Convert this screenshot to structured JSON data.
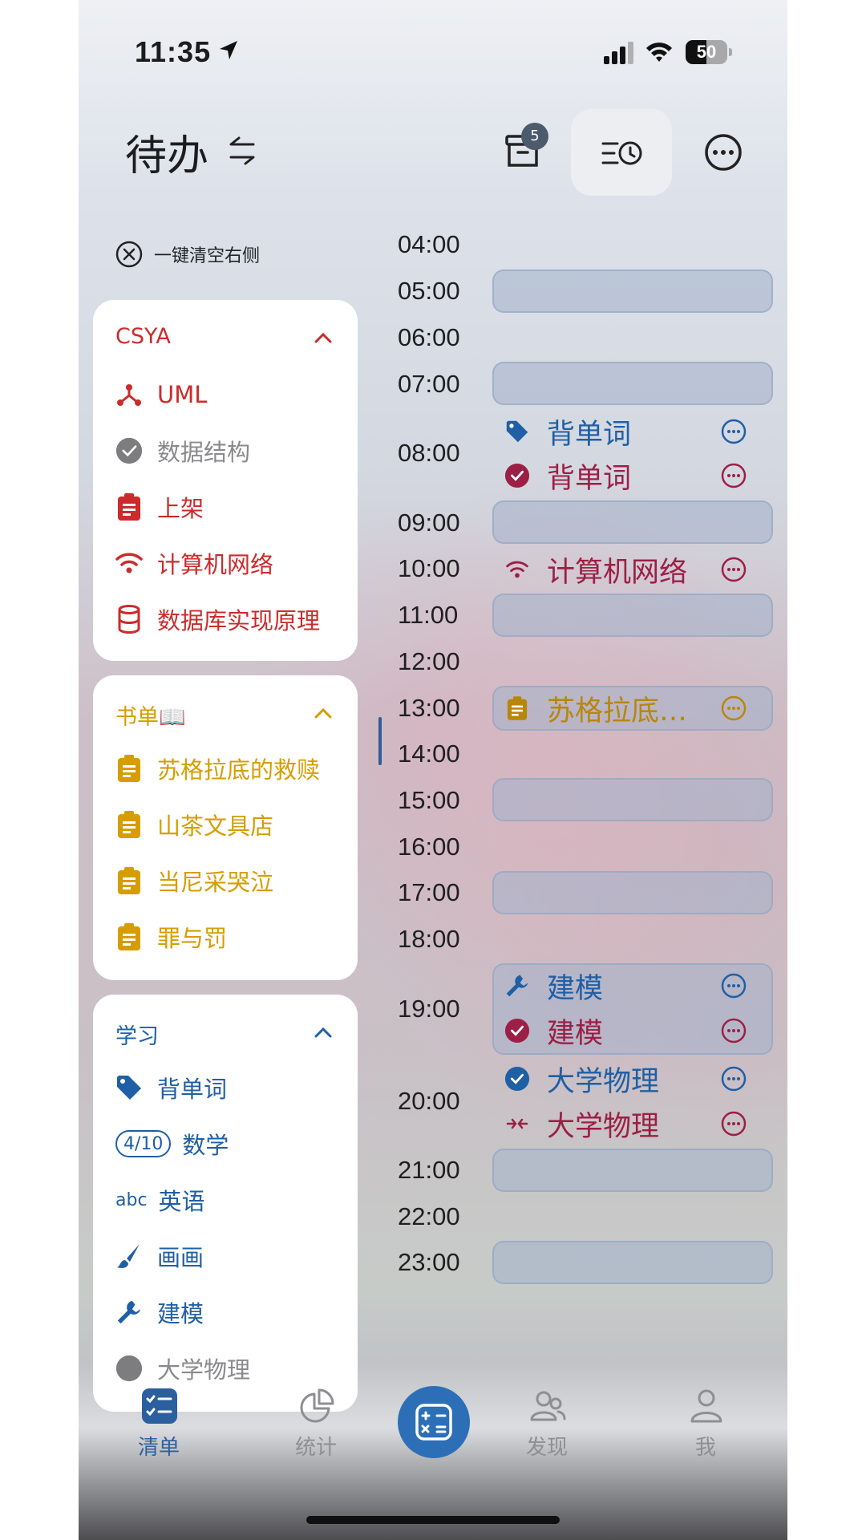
{
  "status_bar": {
    "time": "11:35",
    "battery": "50",
    "battery_level": 0.5
  },
  "header": {
    "title": "待办",
    "archive_badge": "5"
  },
  "clear_right": "一键清空右侧",
  "lists": [
    {
      "title": "CSYA",
      "color": "#cc2b2b",
      "items": [
        {
          "icon": "network-branch-icon",
          "label": "UML"
        },
        {
          "icon": "check-circle-icon",
          "label": "数据结构"
        },
        {
          "icon": "clipboard-icon",
          "label": "上架"
        },
        {
          "icon": "wifi-icon",
          "label": "计算机网络"
        },
        {
          "icon": "database-icon",
          "label": "数据库实现原理"
        }
      ]
    },
    {
      "title": "书单📖",
      "color": "#d69d00",
      "items": [
        {
          "icon": "clipboard-icon",
          "label": "苏格拉底的救赎"
        },
        {
          "icon": "clipboard-icon",
          "label": "山茶文具店"
        },
        {
          "icon": "clipboard-icon",
          "label": "当尼采哭泣"
        },
        {
          "icon": "clipboard-icon",
          "label": "罪与罚"
        }
      ]
    },
    {
      "title": "学习",
      "color": "#1f5fa5",
      "items": [
        {
          "icon": "tag-icon",
          "label": "背单词"
        },
        {
          "icon": "progress-badge",
          "badge": "4/10",
          "label": "数学"
        },
        {
          "icon": "abc-icon",
          "label": "英语",
          "icon_text": "abc"
        },
        {
          "icon": "brush-icon",
          "label": "画画"
        },
        {
          "icon": "wrench-icon",
          "label": "建模"
        },
        {
          "icon": "check-circle-icon",
          "label": "大学物理"
        }
      ]
    }
  ],
  "timeline": {
    "hours": [
      "04:00",
      "05:00",
      "06:00",
      "07:00",
      "08:00",
      "09:00",
      "10:00",
      "11:00",
      "12:00",
      "13:00",
      "14:00",
      "15:00",
      "16:00",
      "17:00",
      "18:00",
      "19:00",
      "20:00",
      "21:00",
      "22:00",
      "23:00"
    ],
    "events": [
      {
        "label": "背单词",
        "icon": "tag-icon",
        "color": "#1f5fa5"
      },
      {
        "label": "背单词",
        "icon": "check-filled-icon",
        "color": "#9c1f45"
      },
      {
        "label": "计算机网络",
        "icon": "wifi-icon",
        "color": "#9c1f45"
      },
      {
        "label": "苏格拉底…",
        "icon": "clipboard-icon",
        "color": "#b8860b"
      },
      {
        "label": "建模",
        "icon": "wrench-icon",
        "color": "#1f5fa5"
      },
      {
        "label": "建模",
        "icon": "check-filled-icon",
        "color": "#9c1f45"
      },
      {
        "label": "大学物理",
        "icon": "check-filled-icon",
        "color": "#1f5fa5"
      },
      {
        "label": "大学物理",
        "icon": "merge-arrows-icon",
        "color": "#9c1f45"
      }
    ]
  },
  "tabbar": {
    "tabs": [
      {
        "label": "清单",
        "icon": "checklist-icon",
        "active": true
      },
      {
        "label": "统计",
        "icon": "pie-chart-icon"
      },
      {
        "label": "发现",
        "icon": "people-icon"
      },
      {
        "label": "我",
        "icon": "person-icon"
      }
    ],
    "center_icon": "calculator-icon"
  }
}
